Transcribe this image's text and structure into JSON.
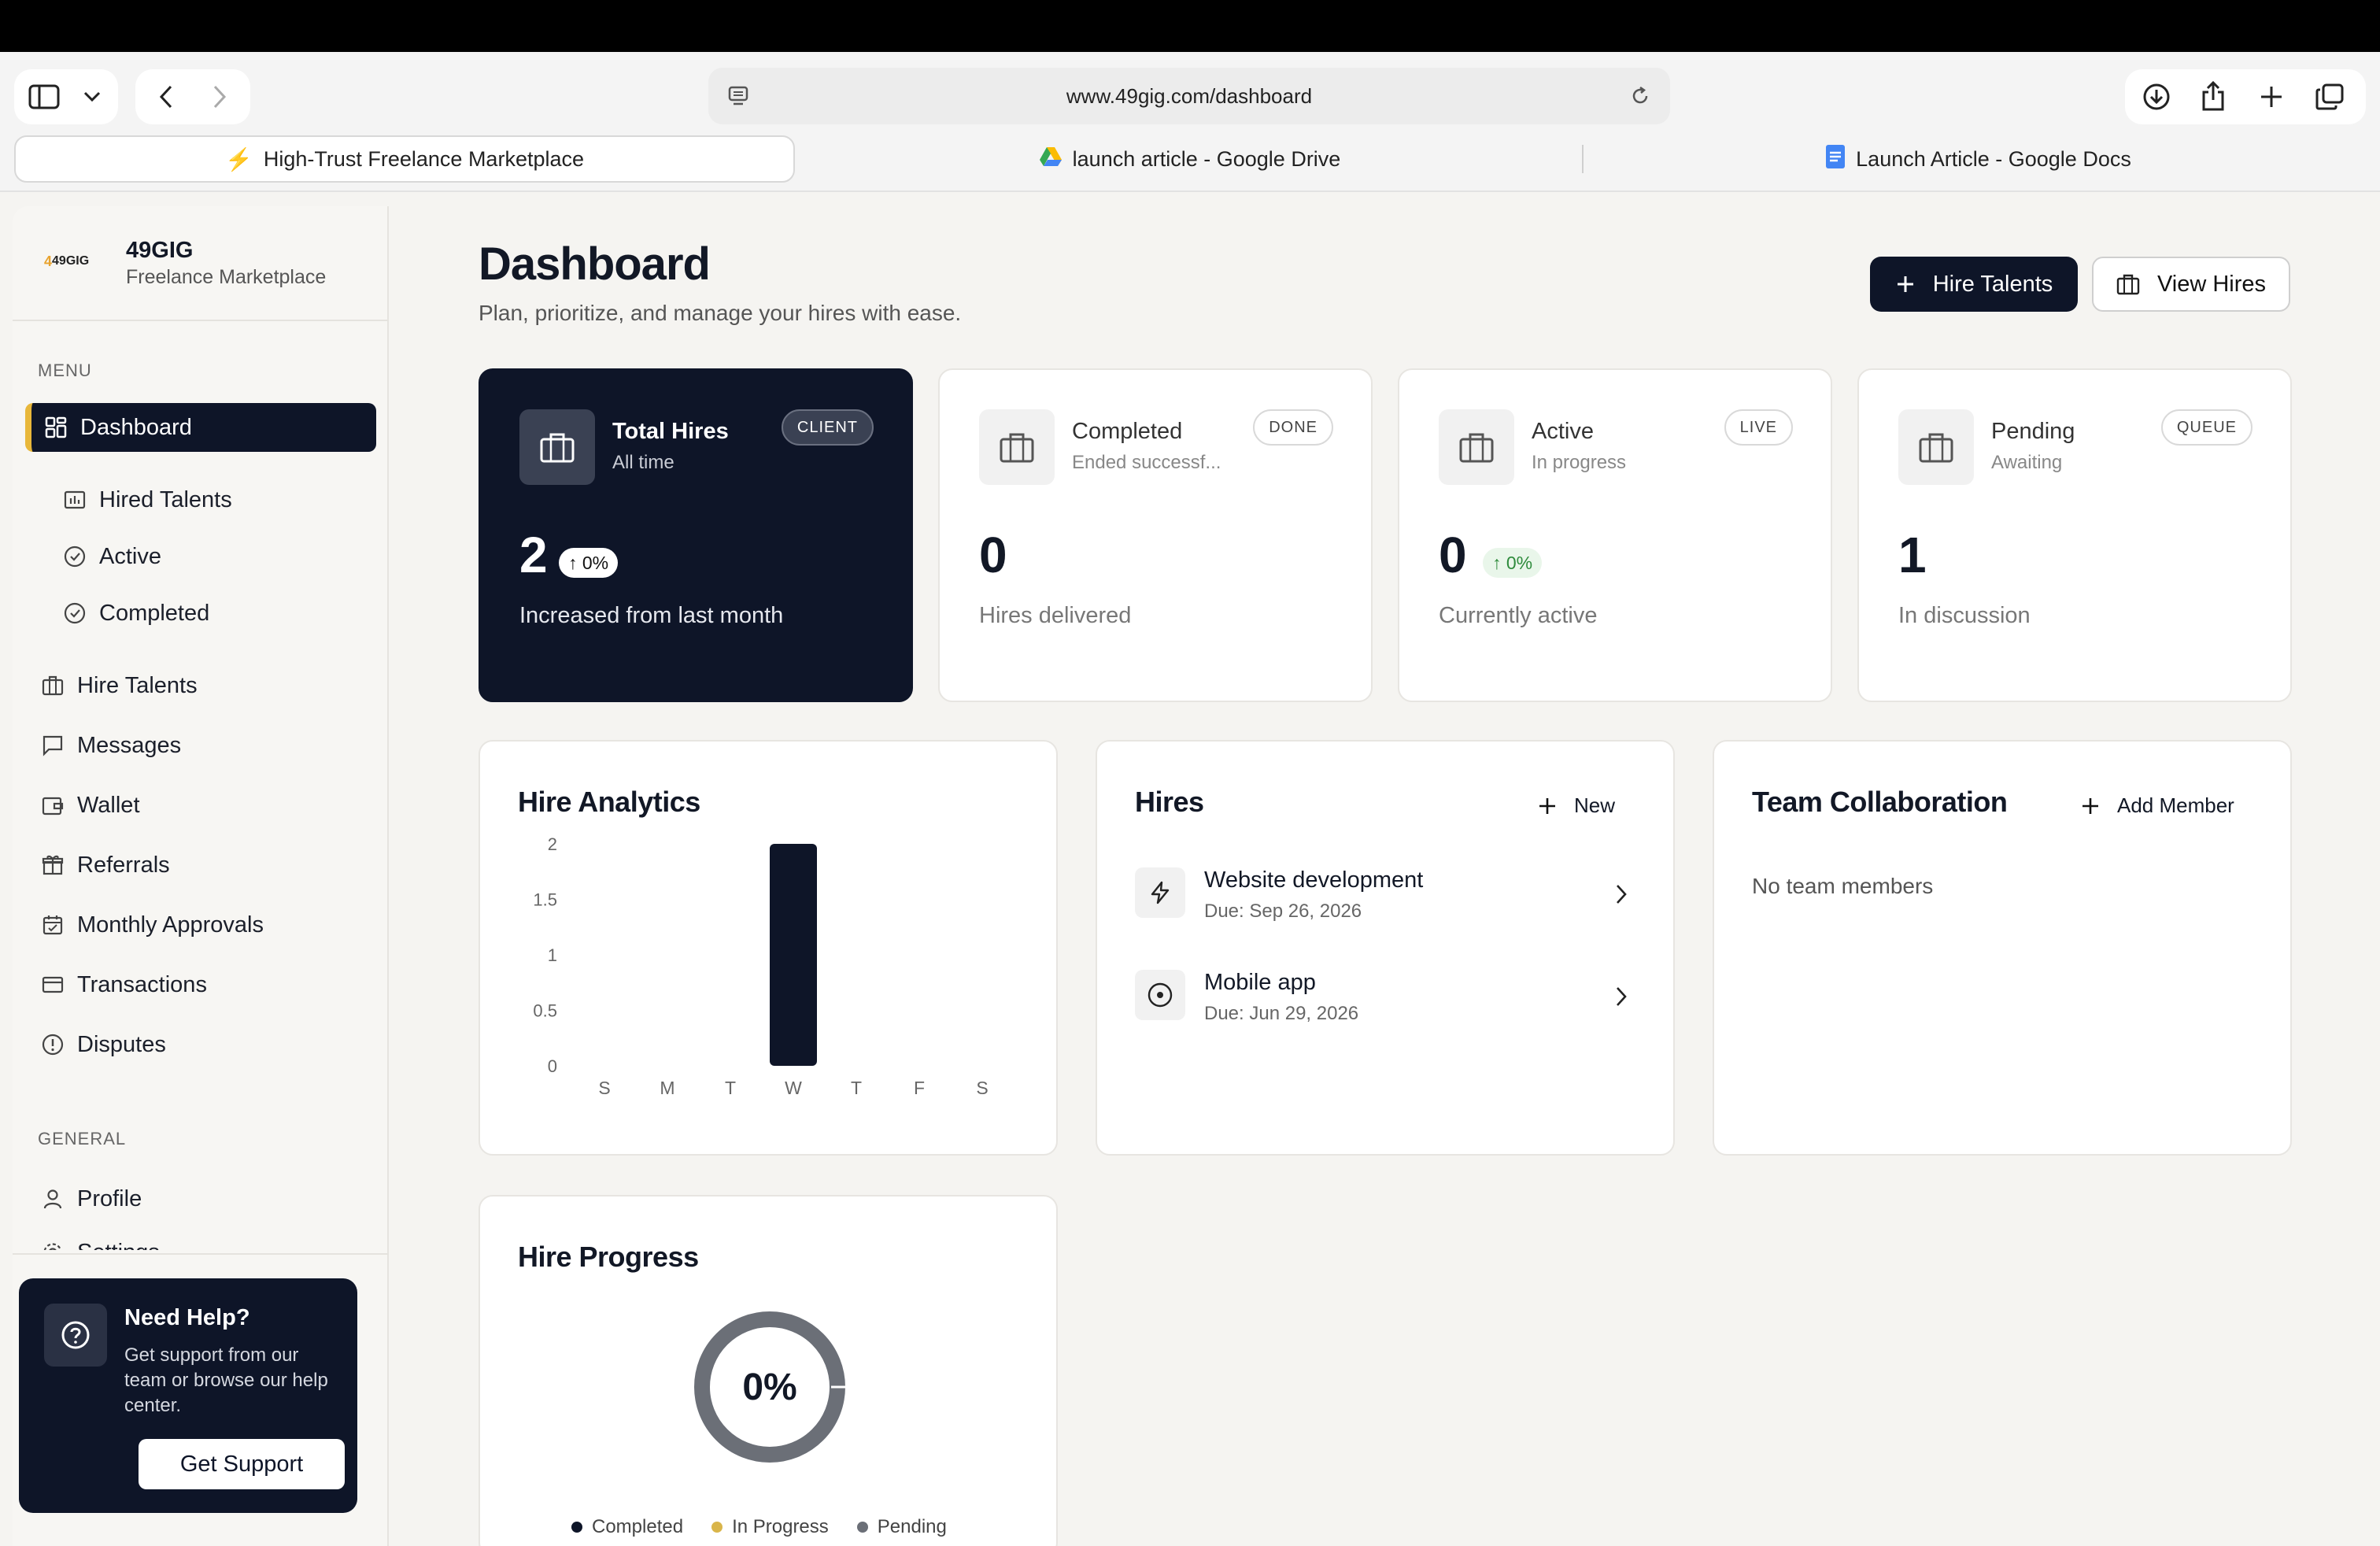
{
  "browser": {
    "url": "www.49gig.com/dashboard",
    "tabs": [
      {
        "label": "High-Trust Freelance Marketplace",
        "active": true
      },
      {
        "label": "launch article - Google Drive",
        "active": false
      },
      {
        "label": "Launch Article - Google Docs",
        "active": false
      }
    ]
  },
  "brand": {
    "logo_text": "49GIG",
    "name": "49GIG",
    "tagline": "Freelance Marketplace"
  },
  "sidebar": {
    "menu_label": "MENU",
    "general_label": "GENERAL",
    "items": [
      {
        "label": "Dashboard",
        "icon": "grid-icon",
        "active": true
      },
      {
        "label": "Hired Talents",
        "icon": "chart-icon"
      },
      {
        "label": "Active",
        "icon": "check-circle-icon"
      },
      {
        "label": "Completed",
        "icon": "check-circle-icon"
      },
      {
        "label": "Hire Talents",
        "icon": "briefcase-icon"
      },
      {
        "label": "Messages",
        "icon": "message-icon"
      },
      {
        "label": "Wallet",
        "icon": "wallet-icon"
      },
      {
        "label": "Referrals",
        "icon": "gift-icon"
      },
      {
        "label": "Monthly Approvals",
        "icon": "calendar-icon"
      },
      {
        "label": "Transactions",
        "icon": "card-icon"
      },
      {
        "label": "Disputes",
        "icon": "alert-icon"
      }
    ],
    "general_items": [
      {
        "label": "Profile",
        "icon": "user-icon"
      },
      {
        "label": "Settings",
        "icon": "gear-icon"
      }
    ],
    "help": {
      "title": "Need Help?",
      "text": "Get support from our team or browse our help center.",
      "button": "Get Support"
    }
  },
  "header": {
    "title": "Dashboard",
    "subtitle": "Plan, prioritize, and manage your hires with ease.",
    "hire_button": "Hire Talents",
    "view_button": "View Hires"
  },
  "stats": [
    {
      "title": "Total Hires",
      "sub": "All time",
      "badge": "CLIENT",
      "value": "2",
      "delta": "↑ 0%",
      "caption": "Increased from last month",
      "dark": true
    },
    {
      "title": "Completed",
      "sub": "Ended successf...",
      "badge": "DONE",
      "value": "0",
      "delta": "",
      "caption": "Hires delivered",
      "dark": false
    },
    {
      "title": "Active",
      "sub": "In progress",
      "badge": "LIVE",
      "value": "0",
      "delta": "↑ 0%",
      "caption": "Currently active",
      "dark": false
    },
    {
      "title": "Pending",
      "sub": "Awaiting",
      "badge": "QUEUE",
      "value": "1",
      "delta": "",
      "caption": "In discussion",
      "dark": false
    }
  ],
  "analytics": {
    "title": "Hire Analytics"
  },
  "chart_data": {
    "type": "bar",
    "categories": [
      "S",
      "M",
      "T",
      "W",
      "T",
      "F",
      "S"
    ],
    "values": [
      0,
      0,
      0,
      2,
      0,
      0,
      0
    ],
    "yticks": [
      "0",
      "0.5",
      "1",
      "1.5",
      "2"
    ],
    "ylim": [
      0,
      2
    ],
    "title": "Hire Analytics",
    "xlabel": "",
    "ylabel": "",
    "bar_color": "#0e1528"
  },
  "hires": {
    "title": "Hires",
    "new_label": "New",
    "items": [
      {
        "name": "Website development",
        "due": "Due: Sep 26, 2026",
        "icon": "bolt-icon"
      },
      {
        "name": "Mobile app",
        "due": "Due: Jun 29, 2026",
        "icon": "target-icon"
      }
    ]
  },
  "team": {
    "title": "Team Collaboration",
    "add_label": "Add Member",
    "empty": "No team members"
  },
  "progress": {
    "title": "Hire Progress",
    "percent": "0%",
    "legend": [
      {
        "label": "Completed",
        "color": "#0e1528"
      },
      {
        "label": "In Progress",
        "color": "#d9b54a"
      },
      {
        "label": "Pending",
        "color": "#6b6f77"
      }
    ]
  }
}
